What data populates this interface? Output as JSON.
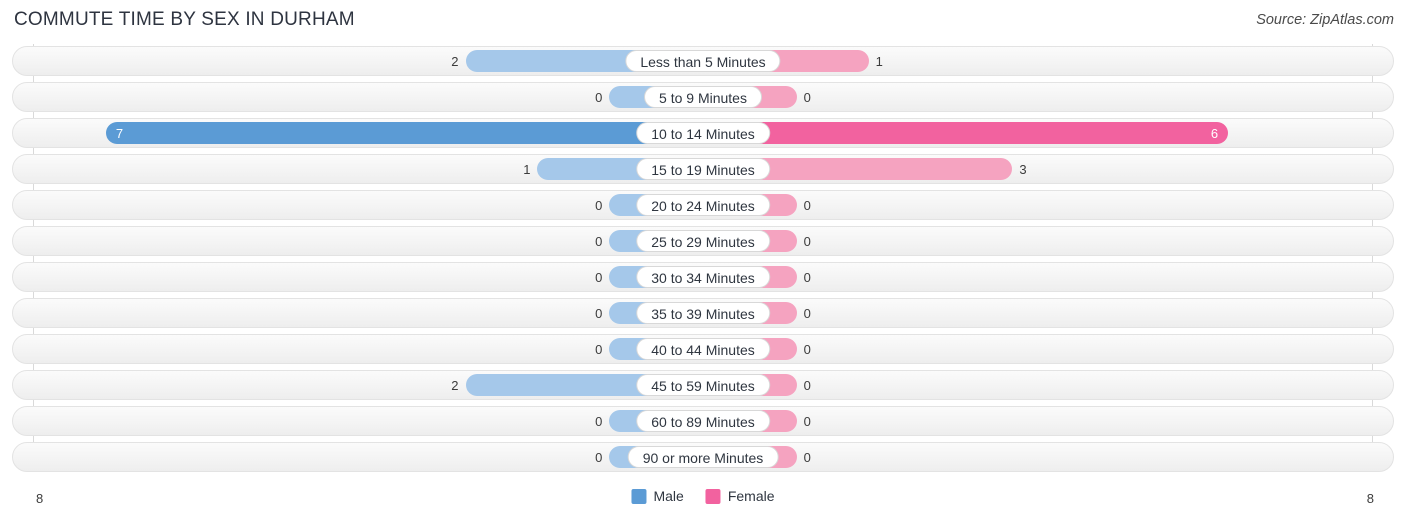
{
  "header": {
    "title": "COMMUTE TIME BY SEX IN DURHAM",
    "source": "Source: ZipAtlas.com"
  },
  "legend": {
    "male_label": "Male",
    "female_label": "Female",
    "male_color": "#5B9BD5",
    "female_color": "#F2629F"
  },
  "axis": {
    "left_end": "8",
    "right_end": "8"
  },
  "colors": {
    "male_strong": "#5B9BD5",
    "male_light": "#A5C8EA",
    "female_strong": "#F2629F",
    "female_light": "#F5A3C0",
    "row_border": "#e3e3e3",
    "pill_border": "#d8d8d8"
  },
  "chart_data": {
    "type": "bar",
    "title": "COMMUTE TIME BY SEX IN DURHAM",
    "subtitle": "Source: ZipAtlas.com",
    "orientation": "horizontal-diverging",
    "xlabel": "",
    "ylabel": "",
    "xlim": [
      8,
      8
    ],
    "grid": false,
    "legend_position": "bottom-center",
    "categories": [
      "Less than 5 Minutes",
      "5 to 9 Minutes",
      "10 to 14 Minutes",
      "15 to 19 Minutes",
      "20 to 24 Minutes",
      "25 to 29 Minutes",
      "30 to 34 Minutes",
      "35 to 39 Minutes",
      "40 to 44 Minutes",
      "45 to 59 Minutes",
      "60 to 89 Minutes",
      "90 or more Minutes"
    ],
    "series": [
      {
        "name": "Male",
        "color": "#5B9BD5",
        "values": [
          2,
          0,
          7,
          1,
          0,
          0,
          0,
          0,
          0,
          2,
          0,
          0
        ]
      },
      {
        "name": "Female",
        "color": "#F2629F",
        "values": [
          1,
          0,
          6,
          3,
          0,
          0,
          0,
          0,
          0,
          0,
          0,
          0
        ]
      }
    ]
  },
  "rows": [
    {
      "category": "Less than 5 Minutes",
      "male": "2",
      "female": "1"
    },
    {
      "category": "5 to 9 Minutes",
      "male": "0",
      "female": "0"
    },
    {
      "category": "10 to 14 Minutes",
      "male": "7",
      "female": "6"
    },
    {
      "category": "15 to 19 Minutes",
      "male": "1",
      "female": "3"
    },
    {
      "category": "20 to 24 Minutes",
      "male": "0",
      "female": "0"
    },
    {
      "category": "25 to 29 Minutes",
      "male": "0",
      "female": "0"
    },
    {
      "category": "30 to 34 Minutes",
      "male": "0",
      "female": "0"
    },
    {
      "category": "35 to 39 Minutes",
      "male": "0",
      "female": "0"
    },
    {
      "category": "40 to 44 Minutes",
      "male": "0",
      "female": "0"
    },
    {
      "category": "45 to 59 Minutes",
      "male": "2",
      "female": "0"
    },
    {
      "category": "60 to 89 Minutes",
      "male": "0",
      "female": "0"
    },
    {
      "category": "90 or more Minutes",
      "male": "0",
      "female": "0"
    }
  ]
}
